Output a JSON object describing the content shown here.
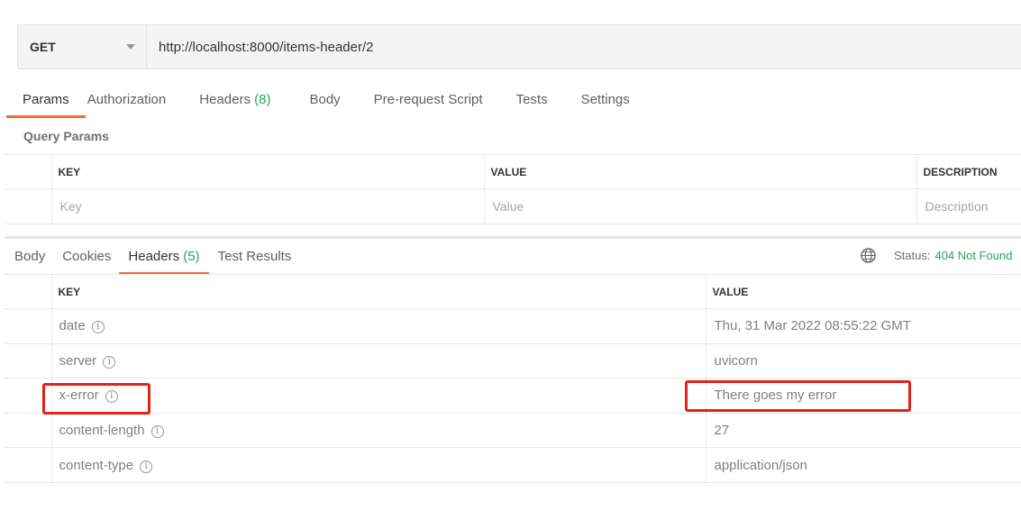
{
  "request": {
    "method": "GET",
    "url": "http://localhost:8000/items-header/2"
  },
  "request_tabs": [
    {
      "label": "Params",
      "count": ""
    },
    {
      "label": "Authorization",
      "count": ""
    },
    {
      "label": "Headers",
      "count": "(8)"
    },
    {
      "label": "Body",
      "count": ""
    },
    {
      "label": "Pre-request Script",
      "count": ""
    },
    {
      "label": "Tests",
      "count": ""
    },
    {
      "label": "Settings",
      "count": ""
    }
  ],
  "query_params": {
    "title": "Query Params",
    "columns": {
      "key": "KEY",
      "value": "VALUE",
      "description": "DESCRIPTION"
    },
    "placeholders": {
      "key": "Key",
      "value": "Value",
      "description": "Description"
    }
  },
  "response_tabs": [
    {
      "label": "Body",
      "count": ""
    },
    {
      "label": "Cookies",
      "count": ""
    },
    {
      "label": "Headers",
      "count": "(5)"
    },
    {
      "label": "Test Results",
      "count": ""
    }
  ],
  "response_status": {
    "label": "Status:",
    "value": "404 Not Found"
  },
  "response_headers": {
    "columns": {
      "key": "KEY",
      "value": "VALUE"
    },
    "rows": [
      {
        "key": "date",
        "value": "Thu, 31 Mar 2022 08:55:22 GMT"
      },
      {
        "key": "server",
        "value": "uvicorn"
      },
      {
        "key": "x-error",
        "value": "There goes my error"
      },
      {
        "key": "content-length",
        "value": "27"
      },
      {
        "key": "content-type",
        "value": "application/json"
      }
    ]
  },
  "colors": {
    "accent": "#f26b3a",
    "success": "#26a65b",
    "highlight": "#e2231a"
  }
}
